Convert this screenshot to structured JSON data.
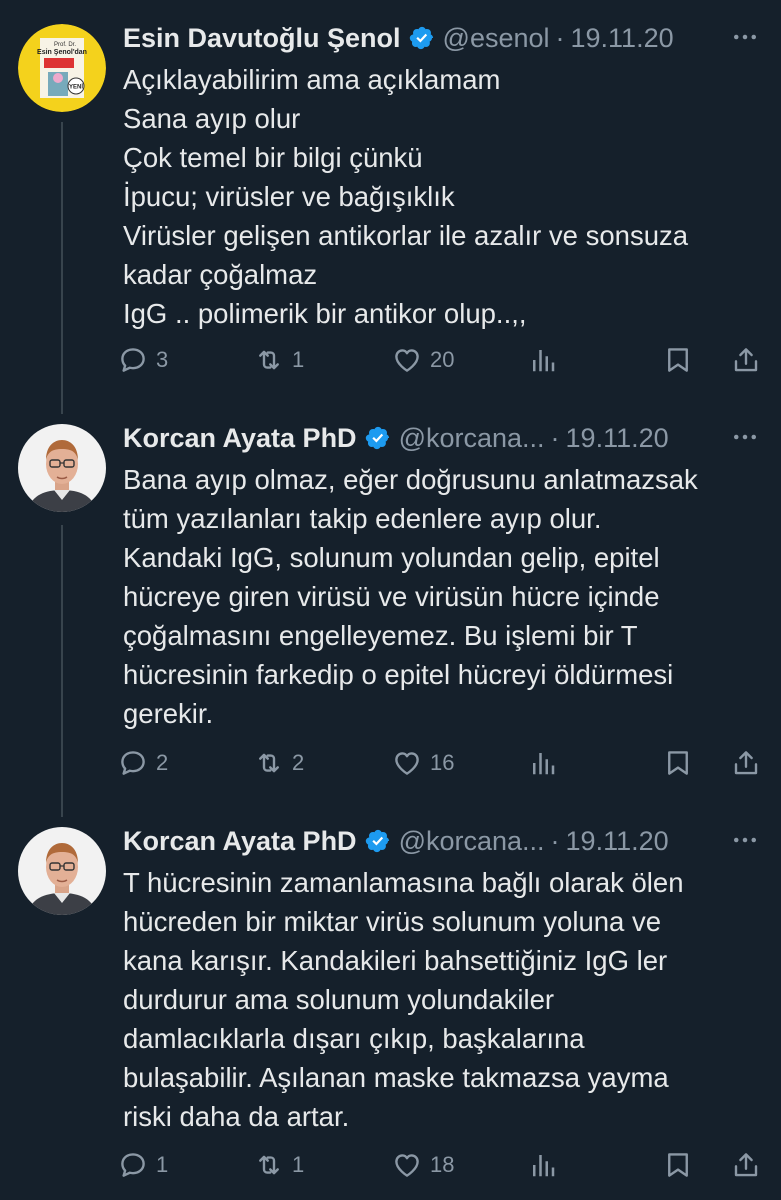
{
  "theme": {
    "background": "#15202b",
    "text": "#e7e9ea",
    "muted": "#8b98a5",
    "verified": "#1d9bf0"
  },
  "tweets": [
    {
      "name": "Esin Davutoğlu Şenol",
      "handle": "@esenol",
      "date": "19.11.20",
      "avatar": {
        "book_author_line1": "Prof. Dr.",
        "book_author_line2": "Esin Şenol'dan",
        "badge": "YENİ"
      },
      "lines": [
        "Açıklayabilirim ama açıklamam",
        "Sana ayıp olur",
        "Çok temel bir bilgi çünkü",
        "İpucu; virüsler ve bağışıklık",
        "Virüsler gelişen antikorlar ile azalır ve sonsuza",
        "kadar çoğalmaz",
        "IgG .. polimerik bir antikor olup..,,"
      ],
      "replies": "3",
      "retweets": "1",
      "likes": "20"
    },
    {
      "name": "Korcan Ayata PhD",
      "handle": "@korcana...",
      "date": "19.11.20",
      "lines": [
        "Bana ayıp olmaz, eğer doğrusunu anlatmazsak",
        "tüm yazılanları takip edenlere ayıp olur.",
        "Kandaki IgG, solunum yolundan gelip, epitel",
        "hücreye giren virüsü ve virüsün hücre içinde",
        "çoğalmasını engelleyemez. Bu işlemi bir T",
        "hücresinin farkedip o epitel hücreyi öldürmesi",
        "gerekir."
      ],
      "replies": "2",
      "retweets": "2",
      "likes": "16"
    },
    {
      "name": "Korcan Ayata PhD",
      "handle": "@korcana...",
      "date": "19.11.20",
      "lines": [
        "T hücresinin zamanlamasına bağlı olarak ölen",
        "hücreden bir miktar virüs solunum yoluna ve",
        "kana karışır. Kandakileri bahsettiğiniz IgG ler",
        "durdurur ama solunum yolundakiler",
        "damlacıklarla dışarı çıkıp, başkalarına",
        "bulaşabilir. Aşılanan maske takmazsa yayma",
        "riski daha da artar."
      ],
      "replies": "1",
      "retweets": "1",
      "likes": "18"
    }
  ],
  "separator": "·",
  "icons": [
    "verified-badge-icon",
    "more-icon",
    "reply-icon",
    "retweet-icon",
    "like-icon",
    "views-icon",
    "bookmark-icon",
    "share-icon"
  ]
}
